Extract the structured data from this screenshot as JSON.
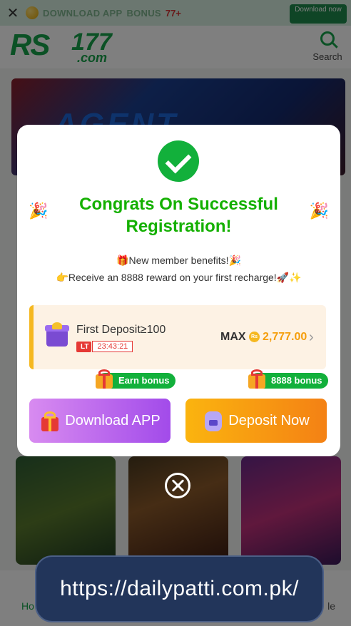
{
  "top_bar": {
    "download_text": "DOWNLOAD APP",
    "bonus_label": "BONUS",
    "bonus_amount": "77+",
    "download_button": "Download now"
  },
  "header": {
    "logo_rs": "RS",
    "logo_number": "177",
    "logo_domain": ".com",
    "search_label": "Search"
  },
  "background": {
    "banner_text": "AGENT",
    "nav_home": "Ho",
    "nav_right": "le"
  },
  "modal": {
    "title": "Congrats On Successful Registration!",
    "benefit_line1": "🎁New member benefits!🎉",
    "benefit_line2": "👉Receive an 8888 reward on your first recharge!🚀✨",
    "deposit_label": "First Deposit≥100",
    "timer_tag": "LT",
    "timer_value": "23:43:21",
    "max_label": "MAX",
    "currency_symbol": "Rs",
    "max_amount": "2,777.00",
    "earn_bonus": "Earn bonus",
    "bonus_8888": "8888 bonus",
    "download_app": "Download APP",
    "deposit_now": "Deposit Now"
  },
  "watermark": {
    "url": "https://dailypatti.com.pk/"
  },
  "colors": {
    "brand_green": "#16a34a",
    "title_green": "#14b000",
    "accent_orange": "#f59e0b",
    "download_purple": "#a24bea",
    "deposit_orange": "#f48114"
  }
}
